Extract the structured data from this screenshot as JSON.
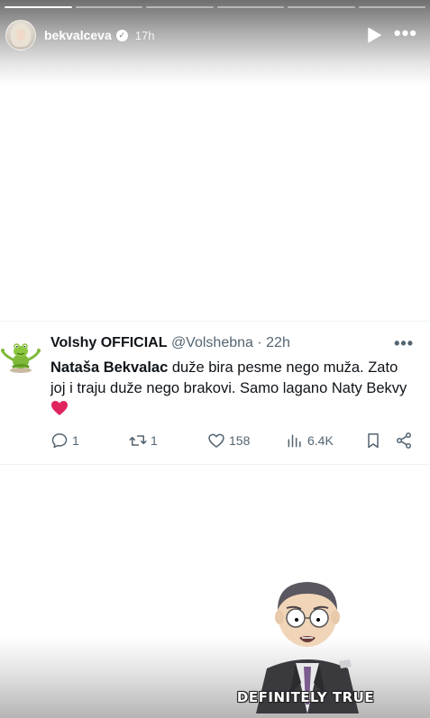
{
  "story": {
    "username": "bekvalceva",
    "time": "17h",
    "segments": 6,
    "active_segment": 1
  },
  "tweet": {
    "display_name": "Volshy OFFICIAL",
    "handle": "@Volshebna",
    "separator": "·",
    "time": "22h",
    "text_bold": "Nataša Bekvalac",
    "text_rest": " duže bira pesme nego muža. Zato joj i traju duže nego brakovi. Samo lagano Naty Bekvy",
    "replies": "1",
    "retweets": "1",
    "likes": "158",
    "views": "6.4K"
  },
  "meme": {
    "caption": "DEFINITELY TRUE"
  },
  "icons": [
    "verified-icon",
    "play-icon",
    "more-icon",
    "heart-emoji",
    "reply-icon",
    "retweet-icon",
    "like-icon",
    "views-icon",
    "bookmark-icon",
    "share-icon"
  ],
  "colors": {
    "heart": "#e0245e",
    "muted_text": "#536471",
    "text": "#0f1419"
  }
}
